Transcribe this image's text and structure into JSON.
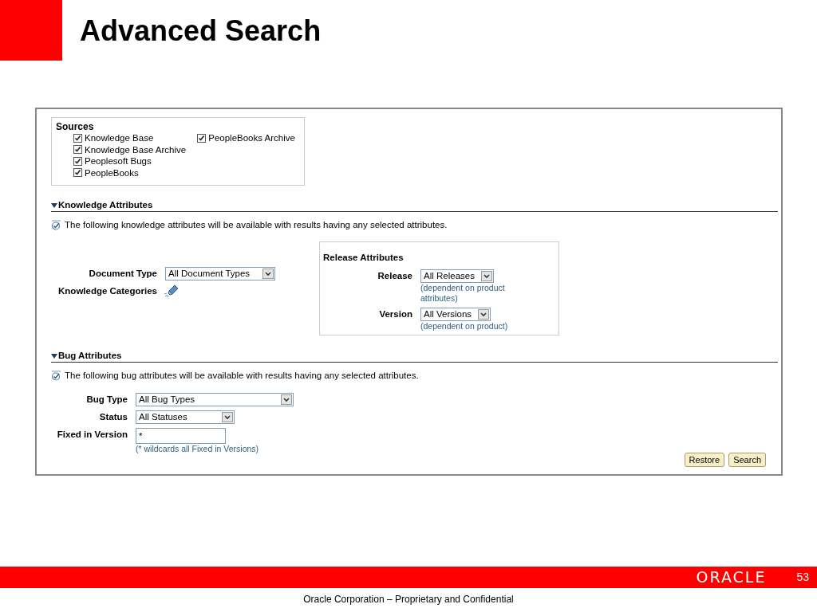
{
  "slide": {
    "title": "Advanced Search",
    "page_number": "53",
    "logo": "ORACLE",
    "footer": "Oracle Corporation – Proprietary and Confidential"
  },
  "sources": {
    "heading": "Sources",
    "items": [
      {
        "label": "Knowledge Base",
        "checked": true
      },
      {
        "label": "Knowledge Base Archive",
        "checked": true
      },
      {
        "label": "Peoplesoft Bugs",
        "checked": true
      },
      {
        "label": "PeopleBooks",
        "checked": true
      },
      {
        "label": "PeopleBooks Archive",
        "checked": true
      }
    ]
  },
  "knowledge_attributes": {
    "heading": "Knowledge Attributes",
    "expanded": true,
    "info": "The following knowledge attributes will be available with results having any selected attributes.",
    "fields": [
      {
        "label": "Document Type",
        "value": "All Document Types"
      }
    ],
    "categories_label": "Knowledge Categories",
    "release_attributes": {
      "heading": "Release Attributes",
      "fields": [
        {
          "label": "Release",
          "value": "All Releases",
          "hint": "(dependent on product attributes)"
        },
        {
          "label": "Version",
          "value": "All Versions",
          "hint": "(dependent on product)"
        }
      ]
    }
  },
  "bug_attributes": {
    "heading": "Bug Attributes",
    "expanded": true,
    "info": "The following bug attributes will be available with results having any selected attributes.",
    "fields": [
      {
        "kind": "select",
        "label": "Bug Type",
        "value": "All Bug Types"
      },
      {
        "kind": "select",
        "label": "Status",
        "value": "All Statuses"
      },
      {
        "kind": "text",
        "label": "Fixed in Version",
        "value": "*",
        "hint": "(* wildcards all Fixed in Versions)"
      }
    ]
  },
  "buttons": [
    "Restore",
    "Search"
  ]
}
